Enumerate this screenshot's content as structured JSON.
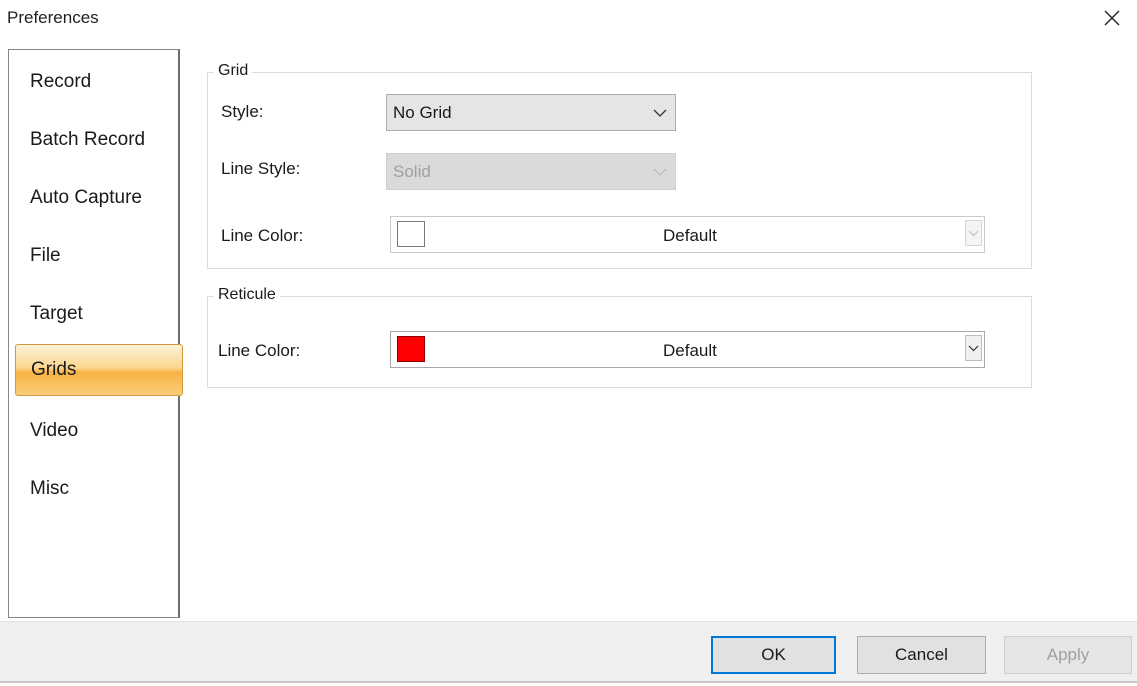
{
  "window": {
    "title": "Preferences"
  },
  "sidebar": {
    "items": [
      {
        "label": "Record"
      },
      {
        "label": "Batch Record"
      },
      {
        "label": "Auto Capture"
      },
      {
        "label": "File"
      },
      {
        "label": "Target"
      },
      {
        "label": "Grids",
        "selected": true
      },
      {
        "label": "Video"
      },
      {
        "label": "Misc"
      }
    ]
  },
  "grid_group": {
    "title": "Grid",
    "style_label": "Style:",
    "style_value": "No Grid",
    "line_style_label": "Line Style:",
    "line_style_value": "Solid",
    "line_style_enabled": false,
    "line_color_label": "Line Color:",
    "line_color_value": "Default",
    "line_color_swatch": "#ffffff",
    "line_color_enabled": false
  },
  "reticule_group": {
    "title": "Reticule",
    "line_color_label": "Line Color:",
    "line_color_value": "Default",
    "line_color_swatch": "#ff0000"
  },
  "footer": {
    "ok_label": "OK",
    "cancel_label": "Cancel",
    "apply_label": "Apply",
    "apply_enabled": false
  },
  "colors": {
    "accent": "#0078d7",
    "selected_item": "#f7b445"
  },
  "icons": {
    "close": "close-icon",
    "dropdown": "chevron-down-icon"
  }
}
